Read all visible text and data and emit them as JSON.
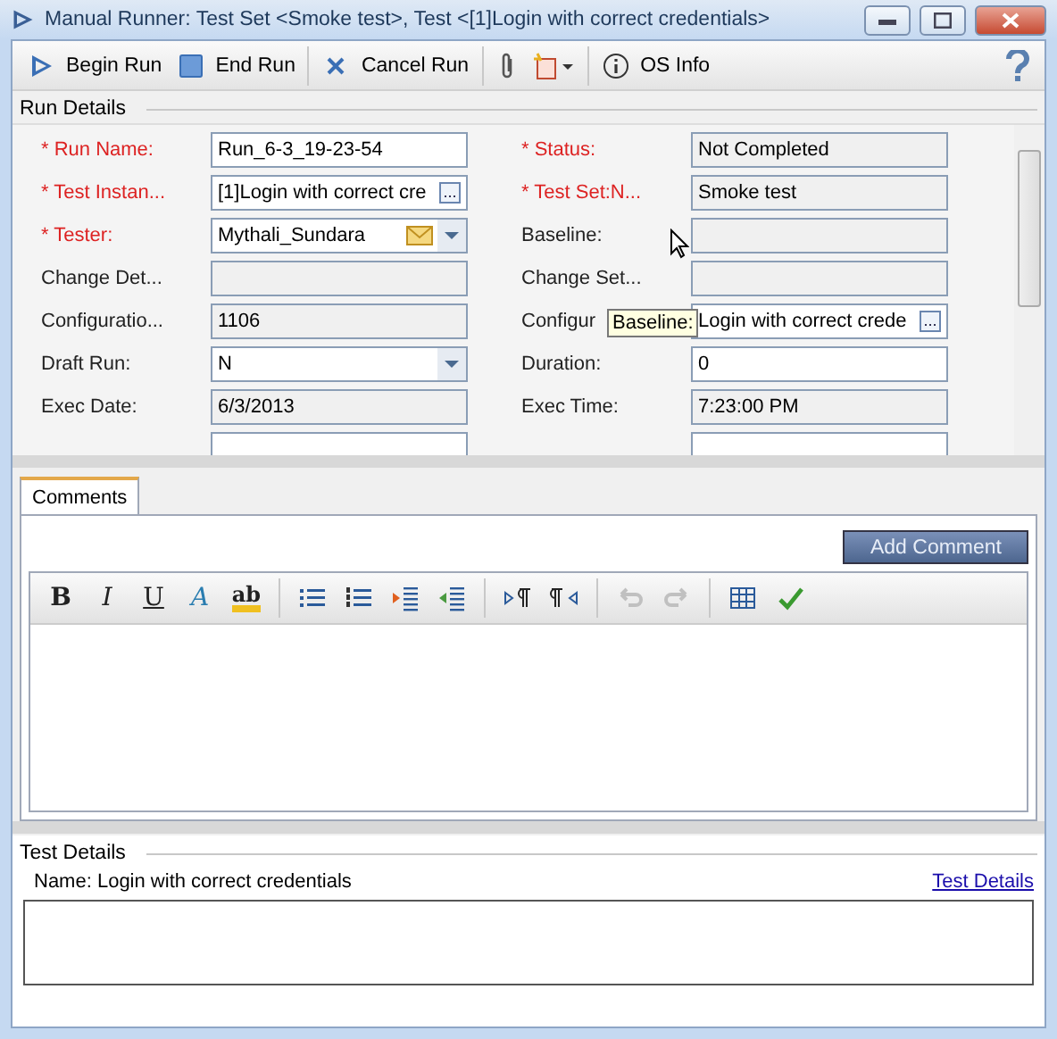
{
  "window": {
    "title": "Manual Runner: Test Set <Smoke test>, Test <[1]Login with correct credentials>"
  },
  "toolbar": [
    {
      "kind": "begin",
      "label": "Begin Run"
    },
    {
      "kind": "end",
      "label": "End Run"
    },
    {
      "kind": "cancel",
      "label": "Cancel Run"
    },
    {
      "kind": "attach"
    },
    {
      "kind": "new"
    },
    {
      "kind": "info",
      "label": "OS Info"
    },
    {
      "kind": "help"
    }
  ],
  "run_details": {
    "title": "Run Details",
    "left": [
      {
        "label": "* Run Name:",
        "required": true,
        "kind": "text",
        "value": "Run_6-3_19-23-54"
      },
      {
        "label": "* Test Instan...",
        "required": true,
        "kind": "lookup",
        "value": "[1]Login with correct cre"
      },
      {
        "label": "* Tester:",
        "required": true,
        "kind": "user",
        "value": "Mythali_Sundara"
      },
      {
        "label": "Change Det...",
        "required": false,
        "kind": "readonly"
      },
      {
        "label": "Configuratio...",
        "required": false,
        "kind": "readonly",
        "value": "1106"
      },
      {
        "label": "Draft Run:",
        "required": false,
        "kind": "combo",
        "value": "N"
      },
      {
        "label": "Exec Date:",
        "required": false,
        "kind": "readonly",
        "value": "6/3/2013"
      },
      {
        "kind": "partial"
      }
    ],
    "right": [
      {
        "label": "* Status:",
        "required": true,
        "kind": "readonly",
        "value": "Not Completed"
      },
      {
        "label": "* Test Set:N...",
        "required": true,
        "kind": "readonly",
        "value": "Smoke test"
      },
      {
        "label": "Baseline:",
        "required": false,
        "kind": "readonly"
      },
      {
        "label": "Change Set...",
        "required": false,
        "kind": "readonly"
      },
      {
        "label": "Configur",
        "required": false,
        "kind": "lookup",
        "value": "Login with correct crede"
      },
      {
        "label": "Duration:",
        "required": false,
        "kind": "text",
        "value": "0"
      },
      {
        "label": "Exec Time:",
        "required": false,
        "kind": "readonly",
        "value": "7:23:00 PM"
      },
      {
        "kind": "partial"
      }
    ],
    "tooltip": "Baseline:"
  },
  "comments": {
    "tabs": [
      {
        "label": "Comments",
        "selected": true
      }
    ],
    "add_button": "Add Comment",
    "editor_tools": [
      {
        "kind": "bold",
        "text": "B"
      },
      {
        "kind": "italic",
        "text": "I"
      },
      {
        "kind": "underline",
        "text": "U"
      },
      {
        "kind": "color",
        "text": "A"
      },
      {
        "kind": "highlight",
        "text": "ab"
      },
      {
        "kind": "sep"
      },
      {
        "kind": "bullets"
      },
      {
        "kind": "numbers"
      },
      {
        "kind": "indent"
      },
      {
        "kind": "outdent"
      },
      {
        "kind": "sep"
      },
      {
        "kind": "ltr"
      },
      {
        "kind": "rtl"
      },
      {
        "kind": "sep"
      },
      {
        "kind": "undo",
        "disabled": true
      },
      {
        "kind": "redo",
        "disabled": true
      },
      {
        "kind": "sep"
      },
      {
        "kind": "table"
      },
      {
        "kind": "spell"
      }
    ]
  },
  "test_details": {
    "title": "Test Details",
    "name": "Name: Login with correct credentials",
    "link": "Test Details"
  }
}
